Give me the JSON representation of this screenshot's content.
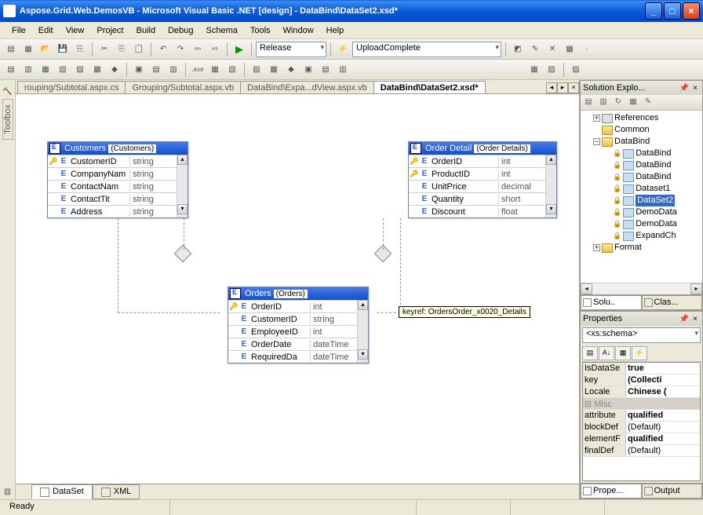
{
  "titlebar": {
    "title": "Aspose.Grid.Web.DemosVB - Microsoft Visual Basic .NET [design] - DataBind\\DataSet2.xsd*"
  },
  "menu": [
    "File",
    "Edit",
    "View",
    "Project",
    "Build",
    "Debug",
    "Schema",
    "Tools",
    "Window",
    "Help"
  ],
  "toolbar1": {
    "config_label": "Release",
    "event_label": "UploadComplete"
  },
  "sidebar": {
    "toolbox": "Toolbox"
  },
  "doctabs": {
    "tabs": [
      "rouping/Subtotal.aspx.cs",
      "Grouping/Subtotal.aspx.vb",
      "DataBind\\Expa...dView.aspx.vb",
      "DataBind\\DataSet2.xsd*"
    ],
    "active": 3
  },
  "entities": {
    "customers": {
      "name": "Customers",
      "desc": "(Customers)",
      "rows": [
        {
          "key": true,
          "fld": "CustomerID",
          "type": "string"
        },
        {
          "key": false,
          "fld": "CompanyNam",
          "type": "string"
        },
        {
          "key": false,
          "fld": "ContactNam",
          "type": "string"
        },
        {
          "key": false,
          "fld": "ContactTit",
          "type": "string"
        },
        {
          "key": false,
          "fld": "Address",
          "type": "string"
        }
      ]
    },
    "orderdetails": {
      "name": "Order Detail",
      "desc": "(Order Details)",
      "rows": [
        {
          "key": true,
          "fld": "OrderID",
          "type": "int"
        },
        {
          "key": true,
          "fld": "ProductID",
          "type": "int"
        },
        {
          "key": false,
          "fld": "UnitPrice",
          "type": "decimal"
        },
        {
          "key": false,
          "fld": "Quantity",
          "type": "short"
        },
        {
          "key": false,
          "fld": "Discount",
          "type": "float"
        }
      ]
    },
    "orders": {
      "name": "Orders",
      "desc": "(Orders)",
      "rows": [
        {
          "key": true,
          "fld": "OrderID",
          "type": "int"
        },
        {
          "key": false,
          "fld": "CustomerID",
          "type": "string"
        },
        {
          "key": false,
          "fld": "EmployeeID",
          "type": "int"
        },
        {
          "key": false,
          "fld": "OrderDate",
          "type": "dateTime"
        },
        {
          "key": false,
          "fld": "RequiredDa",
          "type": "dateTime"
        }
      ]
    }
  },
  "reflabel": "keyref: OrdersOrder_x0020_Details",
  "bottomtabs": {
    "dataset": "DataSet",
    "xml": "XML"
  },
  "solution": {
    "title": "Solution Explo...",
    "nodes": {
      "references": "References",
      "common": "Common",
      "databind": "DataBind",
      "items": [
        "DataBind",
        "DataBind",
        "DataBind",
        "Dataset1",
        "DataSet2",
        "DemoData",
        "DemoData",
        "ExpandCh"
      ],
      "format": "Format"
    },
    "tabs": {
      "solu": "Solu..",
      "class": "Clas..."
    }
  },
  "properties": {
    "title": "Properties",
    "selector": "<xs:schema>",
    "rows": [
      {
        "cat": false,
        "name": "IsDataSe",
        "val": "true",
        "bold": true
      },
      {
        "cat": false,
        "name": "key",
        "val": "(Collecti",
        "bold": true
      },
      {
        "cat": false,
        "name": "Locale",
        "val": "Chinese (",
        "bold": true
      },
      {
        "cat": true,
        "name": "Misc",
        "val": ""
      },
      {
        "cat": false,
        "name": "attribute",
        "val": "qualified",
        "bold": true
      },
      {
        "cat": false,
        "name": "blockDef",
        "val": "(Default)",
        "bold": false
      },
      {
        "cat": false,
        "name": "elementF",
        "val": "qualified",
        "bold": true
      },
      {
        "cat": false,
        "name": "finalDef",
        "val": "(Default)",
        "bold": false
      }
    ],
    "tabs": {
      "prope": "Prope...",
      "output": "Output"
    }
  },
  "statusbar": {
    "ready": "Ready"
  }
}
